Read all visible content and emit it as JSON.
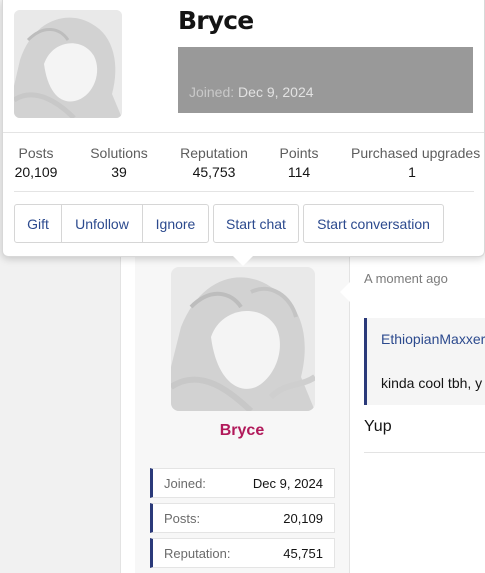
{
  "tooltip": {
    "username": "Bryce",
    "joined_label": "Joined:",
    "joined_date": "Dec 9, 2024",
    "stats": [
      {
        "label": "Posts",
        "value": "20,109"
      },
      {
        "label": "Solutions",
        "value": "39"
      },
      {
        "label": "Reputation",
        "value": "45,753"
      },
      {
        "label": "Points",
        "value": "114"
      },
      {
        "label": "Purchased upgrades",
        "value": "1"
      }
    ],
    "buttons": {
      "gift": "Gift",
      "unfollow": "Unfollow",
      "ignore": "Ignore",
      "start_chat": "Start chat",
      "start_conversation": "Start conversation"
    }
  },
  "post": {
    "username": "Bryce",
    "username_color": "#b1195a",
    "stats": [
      {
        "label": "Joined:",
        "value": "Dec 9, 2024"
      },
      {
        "label": "Posts:",
        "value": "20,109"
      },
      {
        "label": "Reputation:",
        "value": "45,751"
      }
    ],
    "time": "A moment ago",
    "quote_author": "EthiopianMaxxer",
    "quote_text": "kinda cool tbh, y",
    "message": "Yup"
  },
  "colors": {
    "link": "#2c4a8e",
    "accent_border": "#2b3a7a",
    "banner": "#999999"
  }
}
